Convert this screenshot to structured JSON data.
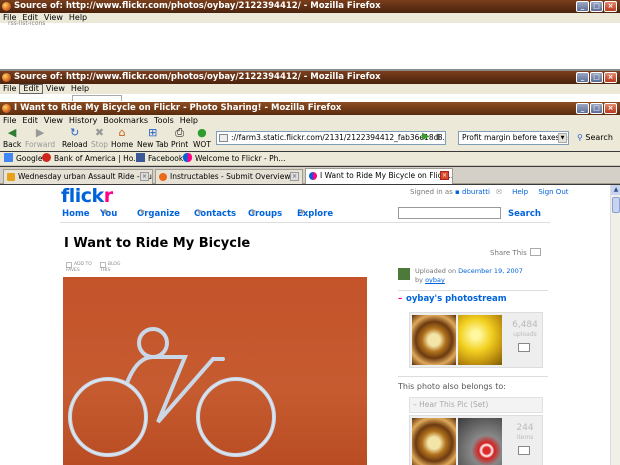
{
  "windows": {
    "back1": {
      "title": "Source of: http://www.flickr.com/photos/oybay/2122394412/ - Mozilla Firefox",
      "menu": [
        "File",
        "Edit",
        "View",
        "Help"
      ],
      "snippet": "rss-list-icons"
    },
    "back2": {
      "title": "Source of: http://www.flickr.com/photos/oybay/2122394412/ - Mozilla Firefox",
      "menu": [
        "File",
        "Edit",
        "View",
        "Help"
      ]
    },
    "main": {
      "title": "I Want to Ride My Bicycle on Flickr - Photo Sharing! - Mozilla Firefox",
      "menu": [
        "File",
        "Edit",
        "View",
        "History",
        "Bookmarks",
        "Tools",
        "Help"
      ]
    }
  },
  "toolbar": {
    "back": "Back",
    "forward": "Forward",
    "reload": "Reload",
    "stop": "Stop",
    "home": "Home",
    "newtab": "New Tab",
    "print": "Print",
    "wot": "WOT",
    "url": "://farm3.static.flickr.com/2131/2122394412_fab36e18c8.jpg",
    "search_value": "Profit margin before taxes &",
    "search_label": "Search"
  },
  "bookmarks": [
    "Google",
    "Bank of America | Ho...",
    "Facebook",
    "Welcome to Flickr - Ph..."
  ],
  "tabs": [
    {
      "label": "Wednesday urban Assault Ride - Au...",
      "color": "#e8a21a"
    },
    {
      "label": "Instructables - Submit Overview",
      "color": "#e86a1a"
    },
    {
      "label": "I Want to Ride My Bicycle on Flick...",
      "color": "#ff0084",
      "active": true
    }
  ],
  "flickr": {
    "logo_a": "flickr",
    "signed_prefix": "Signed in as",
    "user": "dburatti",
    "toplinks": [
      "Help",
      "Sign Out"
    ],
    "nav": [
      "Home",
      "You",
      "Organize",
      "Contacts",
      "Groups",
      "Explore"
    ],
    "search_btn": "Search",
    "photo_title": "I Want to Ride My Bicycle",
    "share": "Share This",
    "fav_label": "ADD TO FAVES",
    "blog_label": "BLOG THIS",
    "uploaded_prefix": "Uploaded on",
    "uploaded_date": "December 19, 2007",
    "by": "by",
    "owner": "oybay",
    "photostream": "oybay's photostream",
    "photostream_count": "6,484",
    "photostream_unit": "uploads",
    "also_belongs": "This photo also belongs to:",
    "set_name": "Hear This Pic (Set)",
    "set_count": "244",
    "set_unit": "items"
  }
}
